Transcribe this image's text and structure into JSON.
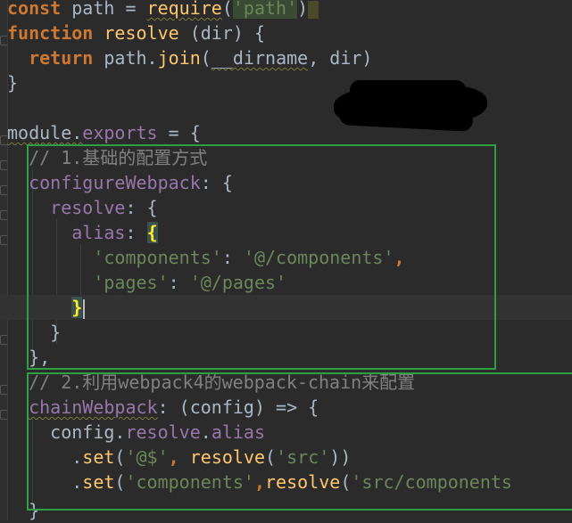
{
  "code": {
    "l1": {
      "kw": "const",
      "ident": " path = ",
      "fn": "require",
      "open": "(",
      "str": "'path'",
      "close": ")"
    },
    "l2": {
      "kw": "function",
      "sp": " ",
      "fn": "resolve",
      "rest": " (dir) {"
    },
    "l3": {
      "indent": "  ",
      "kw": "return",
      "sp": " ",
      "obj": "path.",
      "fn": "join",
      "open": "(",
      "dirname": "__dirname",
      "rest": ", dir)"
    },
    "l4": {
      "text": "}"
    },
    "l6": {
      "mod": "module.",
      "exp": "exports",
      "rest": " = {"
    },
    "l7": {
      "indent": "  ",
      "comment": "// 1.基础的配置方式"
    },
    "l8": {
      "indent": "  ",
      "prop": "configureWebpack",
      "rest": ": {"
    },
    "l9": {
      "indent": "    ",
      "prop": "resolve",
      "rest": ": {"
    },
    "l10": {
      "indent": "      ",
      "prop": "alias",
      "colon": ": ",
      "brace": "{"
    },
    "l11": {
      "indent": "        ",
      "str1": "'components'",
      "colon": ": ",
      "str2": "'@/components'",
      "comma": ","
    },
    "l12": {
      "indent": "        ",
      "str1": "'pages'",
      "colon": ": ",
      "str2": "'@/pages'"
    },
    "l13": {
      "indent": "      ",
      "brace": "}"
    },
    "l14": {
      "indent": "    ",
      "text": "}"
    },
    "l15": {
      "indent": "  ",
      "text": "},"
    },
    "l16": {
      "indent": "  ",
      "comment": "// 2.利用webpack4的webpack-chain来配置"
    },
    "l17": {
      "indent": "  ",
      "prop": "chainWebpack",
      "rest": ": (config) => {"
    },
    "l18": {
      "indent": "    ",
      "obj": "config.",
      "p1": "resolve",
      "dot": ".",
      "p2": "alias"
    },
    "l19": {
      "indent": "      ",
      "dot": ".",
      "fn": "set",
      "open": "(",
      "str": "'@$'",
      "comma": ", ",
      "fn2": "resolve",
      "open2": "(",
      "str2": "'src'",
      "close": "))"
    },
    "l20": {
      "indent": "      ",
      "dot": ".",
      "fn": "set",
      "open": "(",
      "str": "'components'",
      "comma": ",",
      "fn2": "resolve",
      "open2": "(",
      "str2": "'src/components"
    },
    "l21": {
      "indent": "  ",
      "text": "}"
    }
  },
  "colors": {
    "background": "#2b2b2b",
    "keyword": "#cc7832",
    "function": "#ffc66d",
    "string": "#6a8759",
    "property": "#9876aa",
    "comment": "#808080",
    "annotation_box": "#2ea043"
  }
}
